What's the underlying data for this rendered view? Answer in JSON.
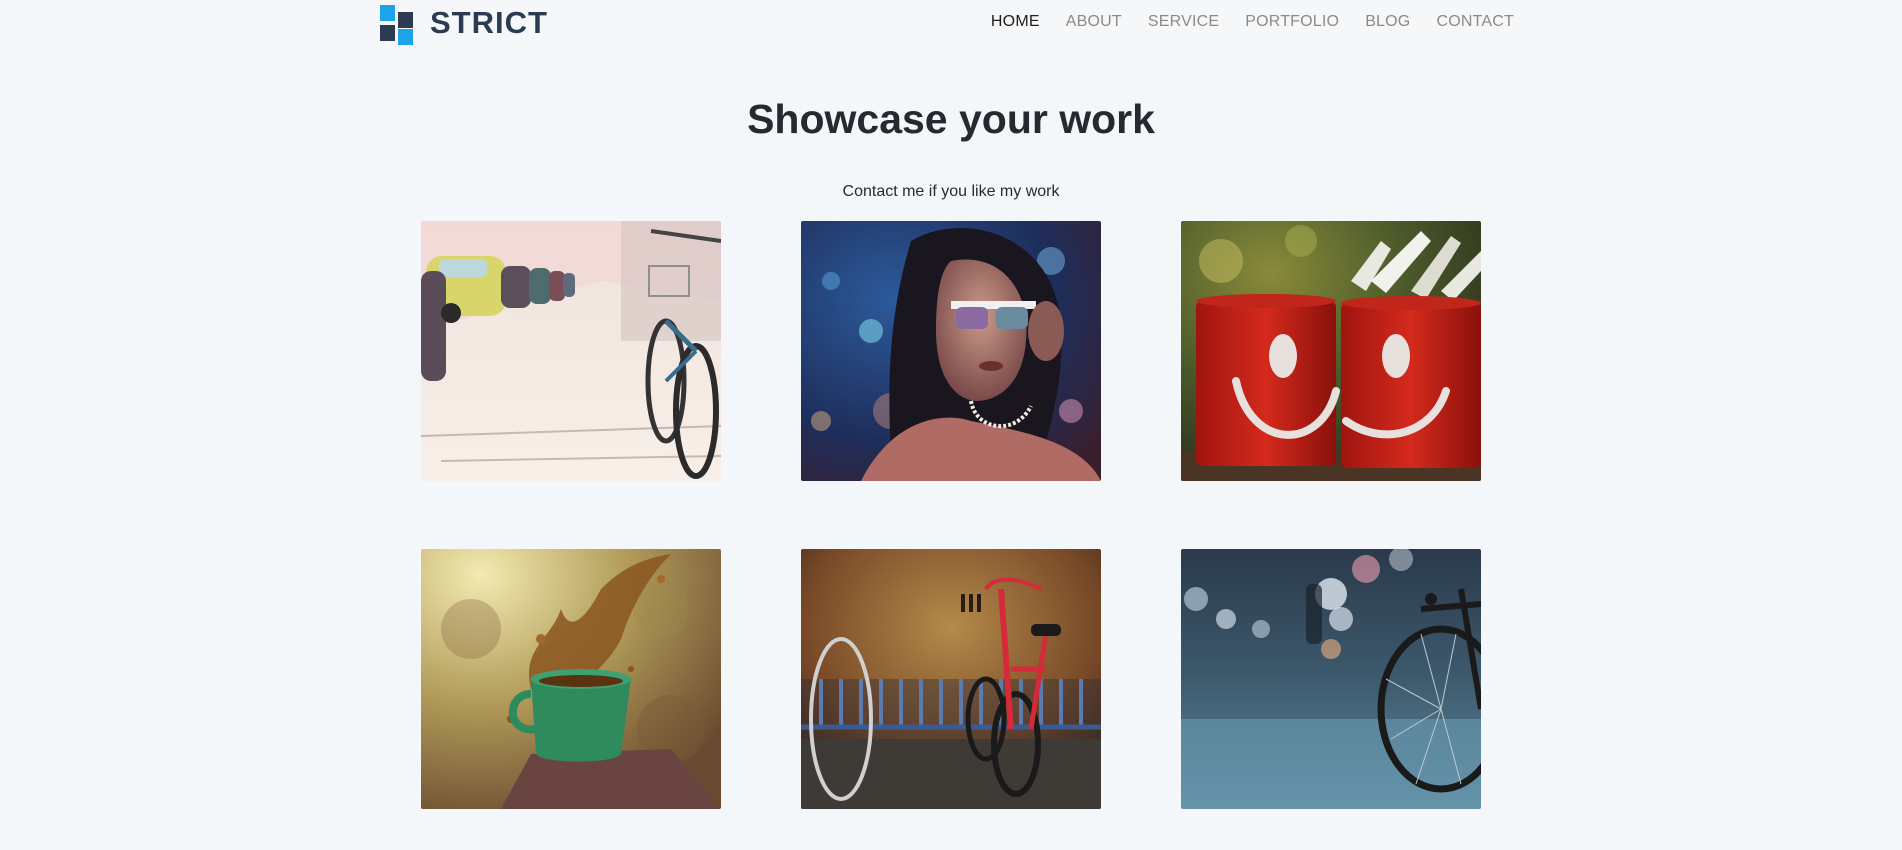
{
  "brand": {
    "name": "STRICT",
    "icon": "logo-squares-icon",
    "colors": {
      "dark": "#2b3c52",
      "accent": "#1fa3e8"
    }
  },
  "nav": {
    "items": [
      {
        "label": "HOME",
        "active": true
      },
      {
        "label": "ABOUT",
        "active": false
      },
      {
        "label": "SERVICE",
        "active": false
      },
      {
        "label": "PORTFOLIO",
        "active": false
      },
      {
        "label": "BLOG",
        "active": false
      },
      {
        "label": "CONTACT",
        "active": false
      }
    ]
  },
  "hero": {
    "title": "Showcase your work",
    "subtitle": "Contact me if you like my work"
  },
  "gallery": {
    "items": [
      {
        "subject": "bicycle-street-photo"
      },
      {
        "subject": "woman-sunglasses-photo"
      },
      {
        "subject": "red-smiley-mugs-photo"
      },
      {
        "subject": "coffee-splash-mug-photo"
      },
      {
        "subject": "red-bicycle-wall-photo"
      },
      {
        "subject": "bicycle-wheel-bokeh-photo"
      }
    ]
  }
}
